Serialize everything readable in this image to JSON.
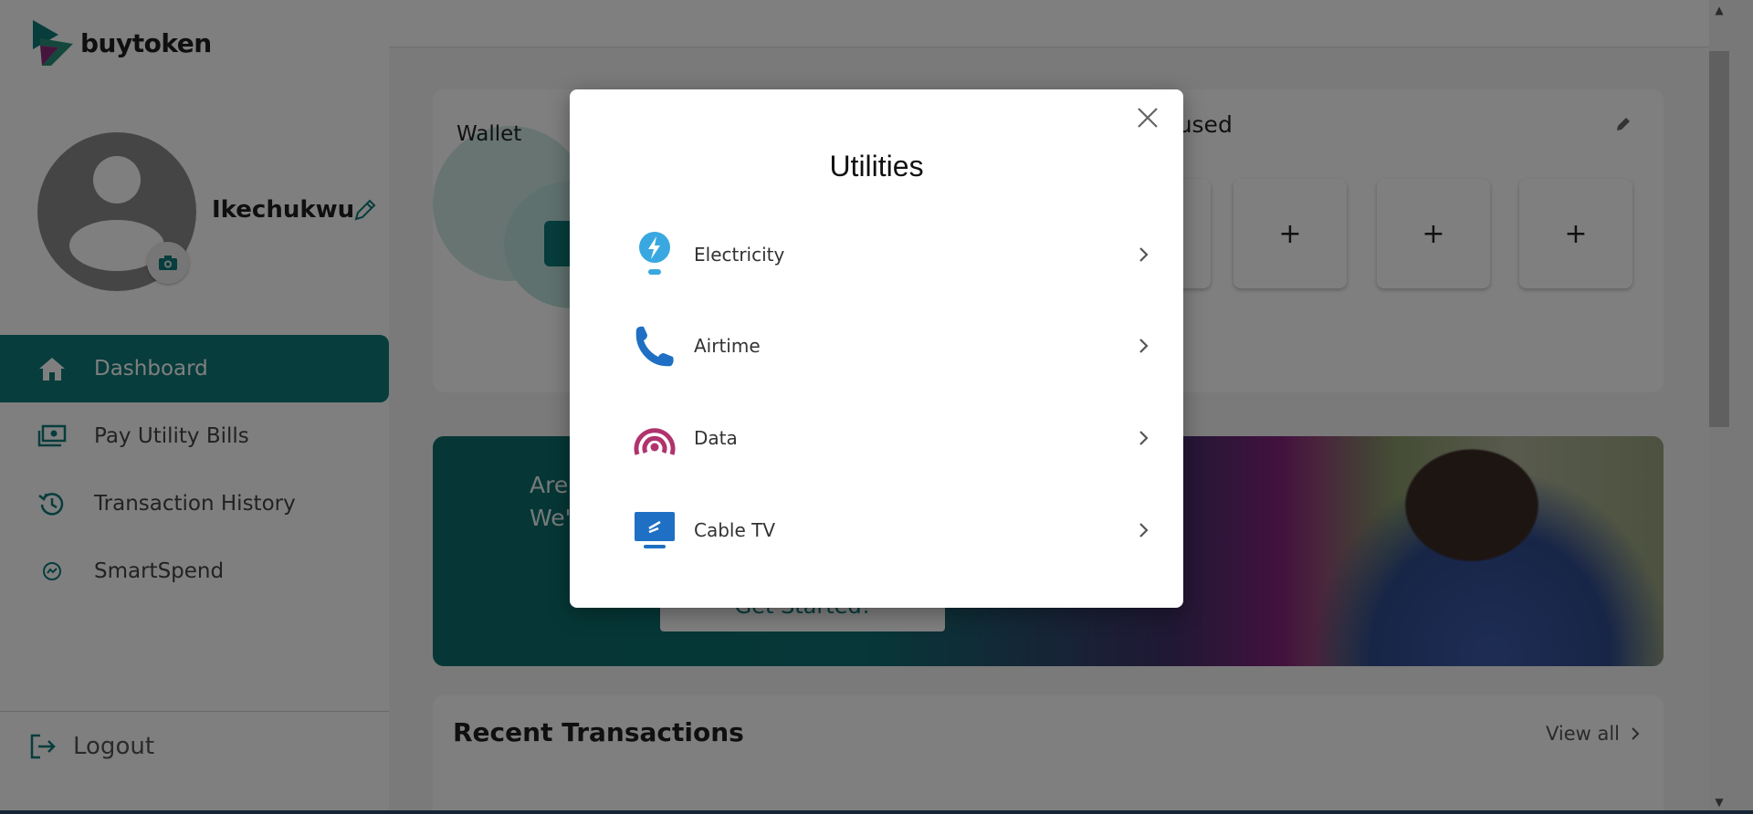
{
  "brand": {
    "name": "buytoken",
    "accent": "#0f7a78"
  },
  "user": {
    "name": "Ikechukwu"
  },
  "sidebar": {
    "items": [
      {
        "label": "Dashboard",
        "icon": "home-icon",
        "active": true
      },
      {
        "label": "Pay Utility Bills",
        "icon": "cash-icon",
        "active": false
      },
      {
        "label": "Transaction History",
        "icon": "history-icon",
        "active": false
      },
      {
        "label": "SmartSpend",
        "icon": "smartspend-icon",
        "active": false
      }
    ],
    "logout_label": "Logout"
  },
  "wallet": {
    "title": "Wallet"
  },
  "favorites": {
    "title": "ly used",
    "slot_symbol": "+"
  },
  "banner": {
    "line1": "Are",
    "line2": "We'",
    "button_label": "Get Started!"
  },
  "transactions": {
    "title": "Recent Transactions",
    "view_all_label": "View all"
  },
  "modal": {
    "title": "Utilities",
    "items": [
      {
        "label": "Electricity",
        "icon": "lightbulb-icon",
        "color": "#3aa8e0"
      },
      {
        "label": "Airtime",
        "icon": "phone-icon",
        "color": "#1f6fc4"
      },
      {
        "label": "Data",
        "icon": "signal-icon",
        "color": "#b0336e"
      },
      {
        "label": "Cable TV",
        "icon": "tv-icon",
        "color": "#1f6fc4"
      }
    ]
  }
}
